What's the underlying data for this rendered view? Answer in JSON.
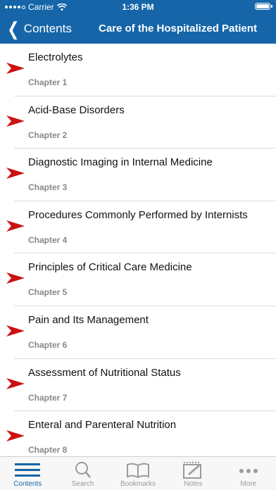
{
  "status_bar": {
    "carrier": "Carrier",
    "time": "1:36 PM"
  },
  "nav": {
    "back_label": "Contents",
    "title": "Care of the Hospitalized Patient"
  },
  "chapters": [
    {
      "title": "Electrolytes",
      "chapter": "Chapter 1"
    },
    {
      "title": "Acid-Base Disorders",
      "chapter": "Chapter 2"
    },
    {
      "title": "Diagnostic Imaging in Internal Medicine",
      "chapter": "Chapter 3"
    },
    {
      "title": "Procedures Commonly Performed by Internists",
      "chapter": "Chapter 4"
    },
    {
      "title": "Principles of Critical Care Medicine",
      "chapter": "Chapter 5"
    },
    {
      "title": "Pain and Its Management",
      "chapter": "Chapter 6"
    },
    {
      "title": "Assessment of Nutritional Status",
      "chapter": "Chapter 7"
    },
    {
      "title": "Enteral and Parenteral Nutrition",
      "chapter": "Chapter 8"
    }
  ],
  "tabs": [
    {
      "label": "Contents",
      "icon": "list-icon",
      "active": true
    },
    {
      "label": "Search",
      "icon": "search-icon",
      "active": false
    },
    {
      "label": "Bookmarks",
      "icon": "book-icon",
      "active": false
    },
    {
      "label": "Notes",
      "icon": "notes-icon",
      "active": false
    },
    {
      "label": "More",
      "icon": "more-icon",
      "active": false
    }
  ],
  "colors": {
    "header_blue": "#1565a8",
    "arrow_red": "#cc1111",
    "tab_active": "#1565a8",
    "tab_inactive": "#9a9a9a"
  }
}
